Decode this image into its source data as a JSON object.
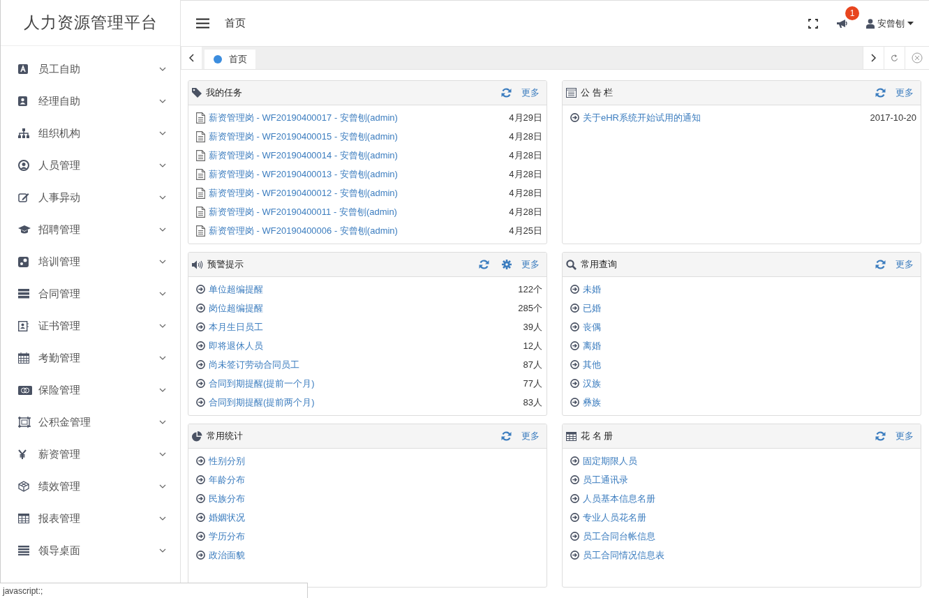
{
  "sidebar": {
    "title": "人力资源管理平台",
    "items": [
      {
        "label": "员工自助"
      },
      {
        "label": "经理自助"
      },
      {
        "label": "组织机构"
      },
      {
        "label": "人员管理"
      },
      {
        "label": "人事异动"
      },
      {
        "label": "招聘管理"
      },
      {
        "label": "培训管理"
      },
      {
        "label": "合同管理"
      },
      {
        "label": "证书管理"
      },
      {
        "label": "考勤管理"
      },
      {
        "label": "保险管理"
      },
      {
        "label": "公积金管理"
      },
      {
        "label": "薪资管理"
      },
      {
        "label": "绩效管理"
      },
      {
        "label": "报表管理"
      },
      {
        "label": "领导桌面"
      }
    ]
  },
  "header": {
    "breadcrumb": "首页",
    "notification_badge": "1",
    "user": "安曾刨"
  },
  "tabs": [
    {
      "label": "首页",
      "selected": true
    }
  ],
  "panels": [
    {
      "title": "我的任务",
      "more": "更多",
      "items": [
        {
          "text": "薪资管理岗 - WF20190400017 - 安曾刨(admin)",
          "value": "4月29日"
        },
        {
          "text": "薪资管理岗 - WF20190400015 - 安曾刨(admin)",
          "value": "4月28日"
        },
        {
          "text": "薪资管理岗 - WF20190400014 - 安曾刨(admin)",
          "value": "4月28日"
        },
        {
          "text": "薪资管理岗 - WF20190400013 - 安曾刨(admin)",
          "value": "4月28日"
        },
        {
          "text": "薪资管理岗 - WF20190400012 - 安曾刨(admin)",
          "value": "4月28日"
        },
        {
          "text": "薪资管理岗 - WF20190400011 - 安曾刨(admin)",
          "value": "4月28日"
        },
        {
          "text": "薪资管理岗 - WF20190400006 - 安曾刨(admin)",
          "value": "4月25日"
        }
      ]
    },
    {
      "title": "公 告 栏",
      "more": "更多",
      "items": [
        {
          "text": "关于eHR系统开始试用的通知",
          "value": "2017-10-20"
        }
      ]
    },
    {
      "title": "预警提示",
      "more": "更多",
      "items": [
        {
          "text": "单位超编提醒",
          "value": "122个"
        },
        {
          "text": "岗位超编提醒",
          "value": "285个"
        },
        {
          "text": "本月生日员工",
          "value": "39人"
        },
        {
          "text": "即将退休人员",
          "value": "12人"
        },
        {
          "text": "尚未签订劳动合同员工",
          "value": "87人"
        },
        {
          "text": "合同到期提醒(提前一个月)",
          "value": "77人"
        },
        {
          "text": "合同到期提醒(提前两个月)",
          "value": "83人"
        }
      ]
    },
    {
      "title": "常用查询",
      "more": "更多",
      "items": [
        {
          "text": "未婚"
        },
        {
          "text": "已婚"
        },
        {
          "text": "丧偶"
        },
        {
          "text": "离婚"
        },
        {
          "text": "其他"
        },
        {
          "text": "汉族"
        },
        {
          "text": "彝族"
        }
      ]
    },
    {
      "title": "常用统计",
      "more": "更多",
      "items": [
        {
          "text": "性别分别"
        },
        {
          "text": "年龄分布"
        },
        {
          "text": "民族分布"
        },
        {
          "text": "婚姻状况"
        },
        {
          "text": "学历分布"
        },
        {
          "text": "政治面貌"
        }
      ]
    },
    {
      "title": "花 名 册",
      "more": "更多",
      "items": [
        {
          "text": "固定期限人员"
        },
        {
          "text": "员工通讯录"
        },
        {
          "text": "人员基本信息名册"
        },
        {
          "text": "专业人员花名册"
        },
        {
          "text": "员工合同台帐信息"
        },
        {
          "text": "员工合同情况信息表"
        }
      ]
    }
  ],
  "status_tip": "javascript:;"
}
